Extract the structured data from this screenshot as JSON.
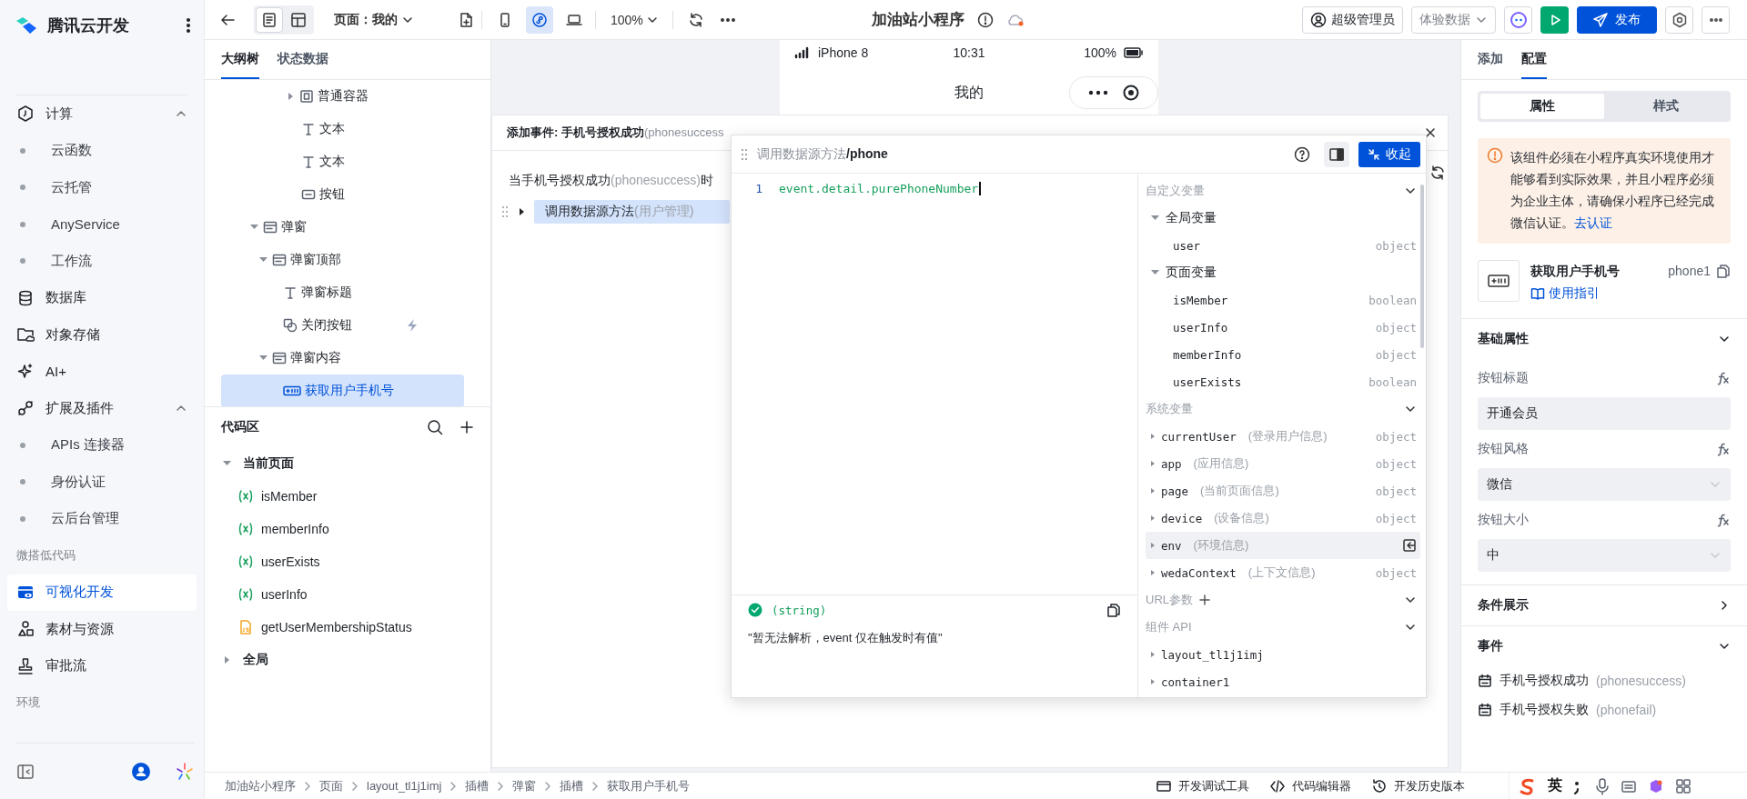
{
  "sidebar": {
    "title": "腾讯云开发",
    "items": [
      {
        "kind": "group",
        "label": "计算",
        "expanded": true,
        "selected": false,
        "children": [
          {
            "label": "云函数",
            "selected": false
          },
          {
            "label": "云托管",
            "selected": false
          },
          {
            "label": "AnyService",
            "selected": false
          },
          {
            "label": "工作流",
            "selected": false
          }
        ]
      },
      {
        "kind": "link",
        "label": "数据库",
        "selected": false
      },
      {
        "kind": "link",
        "label": "对象存储",
        "selected": false
      },
      {
        "kind": "link",
        "label": "AI+",
        "selected": false
      },
      {
        "kind": "group",
        "label": "扩展及插件",
        "expanded": true,
        "selected": false,
        "children": [
          {
            "label": "APIs 连接器",
            "selected": false
          },
          {
            "label": "身份认证",
            "selected": false
          },
          {
            "label": "云后台管理",
            "selected": false
          }
        ]
      },
      {
        "kind": "section",
        "label": "微搭低代码"
      },
      {
        "kind": "link",
        "label": "可视化开发",
        "selected": true
      },
      {
        "kind": "link",
        "label": "素材与资源",
        "selected": false
      },
      {
        "kind": "link",
        "label": "审批流",
        "selected": false
      },
      {
        "kind": "section",
        "label": "环境"
      }
    ]
  },
  "toolbar": {
    "view_modes": [
      {
        "selected": true
      },
      {
        "selected": false
      }
    ],
    "page_selector": "页面：我的",
    "devices": [
      {
        "selected": false
      },
      {
        "selected": true
      },
      {
        "selected": false
      }
    ],
    "zoom": "100%",
    "title": "加油站小程序",
    "user_button": "超级管理员",
    "data_selector": "体验数据",
    "publish_button": "发布"
  },
  "outline": {
    "tabs": [
      {
        "label": "大纲树",
        "selected": true
      },
      {
        "label": "状态数据",
        "selected": false
      }
    ],
    "tree": [
      {
        "children": [
          {
            "children": [
              {
                "children": [
                  {
                    "children": [
                      {
                        "label": "普通容器",
                        "kind": "container",
                        "expanded": false,
                        "selected": false,
                        "has_event": false
                      },
                      {
                        "label": "文本",
                        "kind": "text",
                        "selected": false,
                        "has_event": false
                      },
                      {
                        "label": "文本",
                        "kind": "text",
                        "selected": false,
                        "has_event": false
                      },
                      {
                        "label": "按钮",
                        "kind": "button",
                        "selected": false,
                        "has_event": false
                      }
                    ]
                  }
                ]
              }
            ]
          }
        ]
      },
      {
        "label": "弹窗",
        "kind": "modal",
        "expanded": true,
        "selected": false,
        "has_event": false,
        "children": [
          {
            "label": "弹窗顶部",
            "kind": "modal",
            "expanded": true,
            "selected": false,
            "has_event": false,
            "children": [
              {
                "label": "弹窗标题",
                "kind": "text",
                "selected": false,
                "has_event": false
              },
              {
                "label": "关闭按钮",
                "kind": "icon-button",
                "selected": false,
                "has_event": true
              }
            ]
          },
          {
            "label": "弹窗内容",
            "kind": "modal",
            "expanded": true,
            "selected": false,
            "has_event": false,
            "children": [
              {
                "label": "获取用户手机号",
                "kind": "phone",
                "selected": true,
                "has_event": false
              }
            ]
          }
        ]
      }
    ]
  },
  "code_area": {
    "title": "代码区",
    "groups": [
      {
        "label": "当前页面",
        "expanded": true,
        "items": [
          {
            "kind": "variable",
            "label": "isMember"
          },
          {
            "kind": "variable",
            "label": "memberInfo"
          },
          {
            "kind": "variable",
            "label": "userExists"
          },
          {
            "kind": "variable",
            "label": "userInfo"
          },
          {
            "kind": "script",
            "label": "getUserMembershipStatus"
          }
        ]
      },
      {
        "label": "全局",
        "expanded": false
      }
    ]
  },
  "phone": {
    "device": "iPhone 8",
    "time": "10:31",
    "battery": "100%",
    "nav_title": "我的"
  },
  "event_panel": {
    "title": "添加事件: 手机号授权成功",
    "title_note": "(phonesuccess",
    "trigger": [
      {
        "text": "当手机号授权成功",
        "muted": false
      },
      {
        "text": "(phonesuccess)",
        "muted": true
      },
      {
        "text": "时",
        "muted": false
      }
    ],
    "actions": [
      {
        "label": "调用数据源方法",
        "note": "(用户管理)",
        "selected": true,
        "expanded": false
      }
    ]
  },
  "popup": {
    "source": "调用数据源方法",
    "method": "/phone",
    "collapse_button": "收起",
    "code_lines": [
      {
        "number": "1",
        "text": "event.detail.purePhoneNumber"
      }
    ],
    "result": {
      "ok": true,
      "type": "(string)",
      "message": "\"暂无法解析，event 仅在触发时有值\""
    },
    "sections": [
      {
        "title": "自定义变量",
        "add": false,
        "groups": [
          {
            "label": "全局变量",
            "expanded": true,
            "items": [
              {
                "name": "user",
                "type": "object"
              }
            ]
          },
          {
            "label": "页面变量",
            "expanded": true,
            "items": [
              {
                "name": "isMember",
                "type": "boolean"
              },
              {
                "name": "userInfo",
                "type": "object"
              },
              {
                "name": "memberInfo",
                "type": "object"
              },
              {
                "name": "userExists",
                "type": "boolean"
              }
            ]
          }
        ]
      },
      {
        "title": "系统变量",
        "add": false,
        "items": [
          {
            "name": "currentUser",
            "note": "(登录用户信息)",
            "type": "object",
            "hovered": false
          },
          {
            "name": "app",
            "note": "(应用信息)",
            "type": "object",
            "hovered": false
          },
          {
            "name": "page",
            "note": "(当前页面信息)",
            "type": "object",
            "hovered": false
          },
          {
            "name": "device",
            "note": "(设备信息)",
            "type": "object",
            "hovered": false
          },
          {
            "name": "env",
            "note": "(环境信息)",
            "hovered": true
          },
          {
            "name": "wedaContext",
            "note": "(上下文信息)",
            "type": "object",
            "hovered": false
          }
        ]
      },
      {
        "title": "URL参数",
        "add": true
      },
      {
        "title": "组件 API",
        "add": false,
        "items": [
          {
            "name": "layout_tl1j1imj",
            "hovered": false
          },
          {
            "name": "container1",
            "hovered": false
          }
        ]
      }
    ]
  },
  "right_panel": {
    "tabs": [
      {
        "label": "添加",
        "selected": false
      },
      {
        "label": "配置",
        "selected": true
      }
    ],
    "segments": [
      {
        "label": "属性",
        "selected": true
      },
      {
        "label": "样式",
        "selected": false
      }
    ],
    "notice": {
      "text": "该组件必须在小程序真实环境使用才能够看到实际效果，并且小程序必须为企业主体，请确保小程序已经完成微信认证。",
      "link": "去认证"
    },
    "component": {
      "name": "获取用户手机号",
      "guide": "使用指引",
      "id": "phone1"
    },
    "sections": [
      {
        "title": "基础属性",
        "expanded": true,
        "fields": [
          {
            "label": "按钮标题",
            "kind": "input",
            "value": "开通会员"
          },
          {
            "label": "按钮风格",
            "kind": "select",
            "value": "微信"
          },
          {
            "label": "按钮大小",
            "kind": "select",
            "value": "中"
          }
        ]
      },
      {
        "title": "条件展示",
        "expanded": false
      },
      {
        "title": "事件",
        "expanded": true,
        "events": [
          {
            "label": "手机号授权成功",
            "code": "(phonesuccess)"
          },
          {
            "label": "手机号授权失败",
            "code": "(phonefail)"
          }
        ]
      }
    ]
  },
  "breadcrumb": [
    "加油站小程序",
    "页面",
    "layout_tl1j1imj",
    "插槽",
    "弹窗",
    "插槽",
    "获取用户手机号"
  ],
  "footer_tools": [
    {
      "label": "开发调试工具"
    },
    {
      "label": "代码编辑器"
    },
    {
      "label": "开发历史版本"
    }
  ],
  "ime": {
    "mode": "英"
  }
}
